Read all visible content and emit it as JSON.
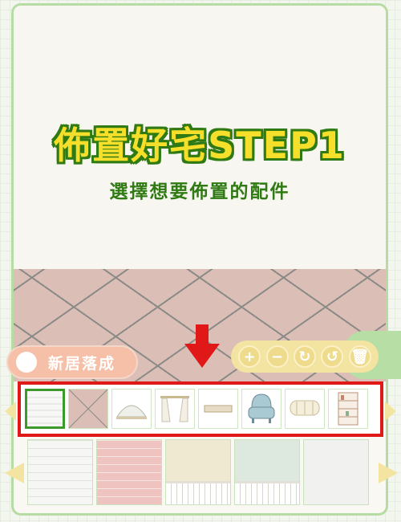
{
  "header": {
    "title": "佈置好宅STEP1",
    "subtitle": "選擇想要佈置的配件"
  },
  "actions": {
    "finish_label": "新居落成"
  },
  "tools": [
    "+",
    "−",
    "↻",
    "↺",
    "🗑"
  ],
  "accessories": {
    "items": [
      "white-brick-wall",
      "pink-tile-floor",
      "arch-window",
      "curtain",
      "rug",
      "armchair",
      "sofa-bench",
      "bookshelf"
    ],
    "selected_index": 0
  },
  "wall_options": [
    "white-brick",
    "red-brick",
    "beige-wainscot",
    "green-wainscot",
    "light-gray"
  ],
  "colors": {
    "frame_green": "#b6dca3",
    "title_yellow": "#f5df2a",
    "title_green": "#2f7a12",
    "highlight_red": "#e01818",
    "finish_peach": "#f6c0a8",
    "toolbar_yellow": "#f3e4a2"
  }
}
